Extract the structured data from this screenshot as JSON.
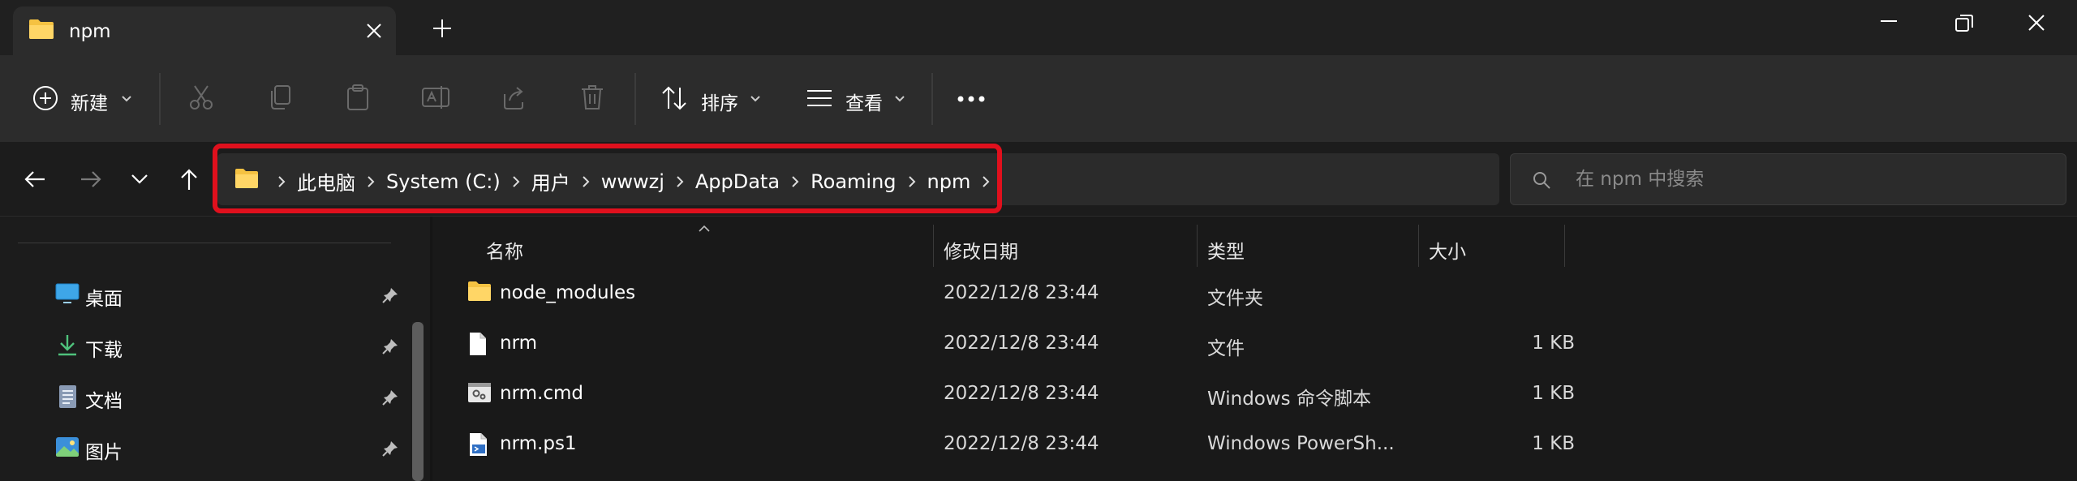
{
  "window": {
    "tab_title": "npm"
  },
  "command_bar": {
    "new_label": "新建",
    "sort_label": "排序",
    "view_label": "查看",
    "icons": [
      "new-icon",
      "cut-icon",
      "copy-icon",
      "paste-icon",
      "rename-icon",
      "share-icon",
      "delete-icon",
      "sort-icon",
      "view-icon",
      "more-icon"
    ]
  },
  "address": {
    "crumbs": [
      "此电脑",
      "System (C:)",
      "用户",
      "wwwzj",
      "AppData",
      "Roaming",
      "npm"
    ]
  },
  "search": {
    "placeholder": "在 npm 中搜索"
  },
  "sidebar": {
    "items": [
      {
        "label": "桌面",
        "icon": "desktop-icon",
        "pinned": true
      },
      {
        "label": "下载",
        "icon": "download-icon",
        "pinned": true
      },
      {
        "label": "文档",
        "icon": "documents-icon",
        "pinned": true
      },
      {
        "label": "图片",
        "icon": "pictures-icon",
        "pinned": true
      }
    ]
  },
  "file_list": {
    "columns": {
      "name": "名称",
      "modified": "修改日期",
      "type": "类型",
      "size": "大小"
    },
    "sort_column": "名称",
    "rows": [
      {
        "name": "node_modules",
        "modified": "2022/12/8 23:44",
        "type": "文件夹",
        "size": "",
        "icon": "folder-icon"
      },
      {
        "name": "nrm",
        "modified": "2022/12/8 23:44",
        "type": "文件",
        "size": "1 KB",
        "icon": "file-icon"
      },
      {
        "name": "nrm.cmd",
        "modified": "2022/12/8 23:44",
        "type": "Windows 命令脚本",
        "size": "1 KB",
        "icon": "cmd-script-icon"
      },
      {
        "name": "nrm.ps1",
        "modified": "2022/12/8 23:44",
        "type": "Windows PowerSh...",
        "size": "1 KB",
        "icon": "powershell-script-icon"
      }
    ]
  },
  "colors": {
    "highlight_border": "#e0101d",
    "folder": "#f5c242",
    "background": "#1c1c1c"
  }
}
